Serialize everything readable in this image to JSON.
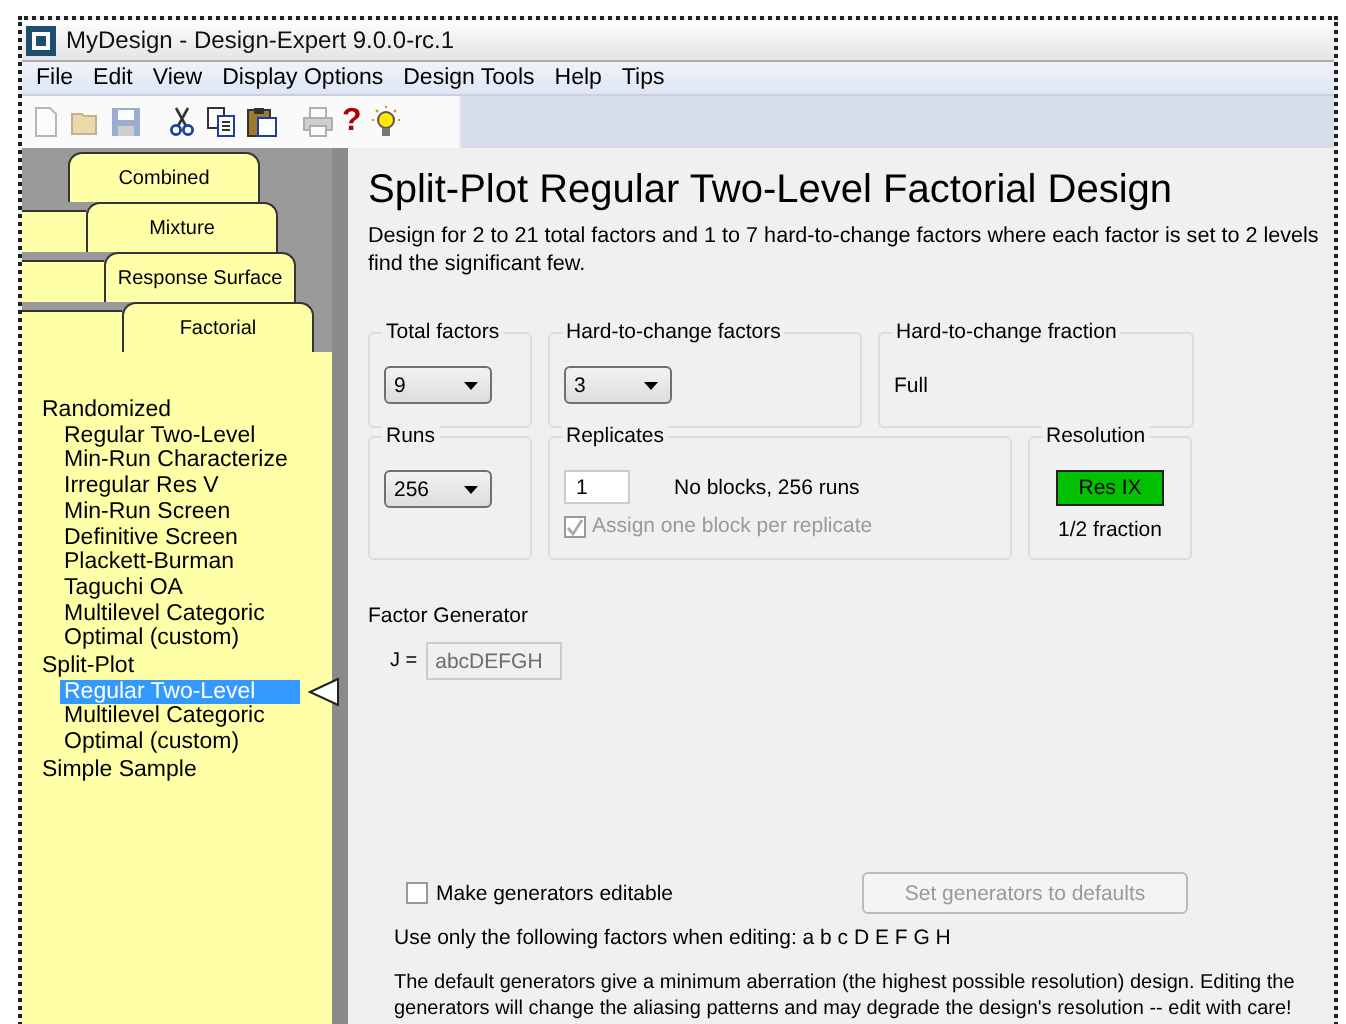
{
  "window": {
    "title": "MyDesign - Design-Expert 9.0.0-rc.1"
  },
  "menu": [
    {
      "label": "File"
    },
    {
      "label": "Edit"
    },
    {
      "label": "View"
    },
    {
      "label": "Display Options"
    },
    {
      "label": "Design Tools"
    },
    {
      "label": "Help"
    },
    {
      "label": "Tips"
    }
  ],
  "toolbar": [
    {
      "kind": "new",
      "disabled": true
    },
    {
      "kind": "open",
      "disabled": true
    },
    {
      "kind": "save",
      "disabled": true
    },
    {
      "kind": "cut",
      "disabled": false,
      "separator_before": true
    },
    {
      "kind": "copy",
      "disabled": false
    },
    {
      "kind": "paste",
      "disabled": false
    },
    {
      "kind": "print",
      "disabled": true,
      "separator_before": true
    },
    {
      "kind": "help",
      "text": "?",
      "disabled": false
    },
    {
      "kind": "tip",
      "disabled": false
    }
  ],
  "tabs": [
    {
      "label": "Combined",
      "selected": false
    },
    {
      "label": "Mixture",
      "selected": false
    },
    {
      "label": "Response Surface",
      "selected": false
    },
    {
      "label": "Factorial",
      "selected": true
    }
  ],
  "tree": [
    {
      "label": "Randomized",
      "selected": false,
      "children": [
        {
          "label": "Regular Two-Level",
          "selected": false
        },
        {
          "label": "Min-Run Characterize",
          "selected": false
        },
        {
          "label": "Irregular Res V",
          "selected": false
        },
        {
          "label": "Min-Run Screen",
          "selected": false
        },
        {
          "label": "Definitive Screen",
          "selected": false
        },
        {
          "label": "Plackett-Burman",
          "selected": false
        },
        {
          "label": "Taguchi OA",
          "selected": false
        },
        {
          "label": "Multilevel Categoric",
          "selected": false
        },
        {
          "label": "Optimal (custom)",
          "selected": false
        }
      ]
    },
    {
      "label": "Split-Plot",
      "selected": false,
      "children": [
        {
          "label": "Regular Two-Level",
          "selected": true
        },
        {
          "label": "Multilevel Categoric",
          "selected": false
        },
        {
          "label": "Optimal (custom)",
          "selected": false
        }
      ]
    },
    {
      "label": "Simple Sample",
      "selected": false
    }
  ],
  "page": {
    "title": "Split-Plot Regular Two-Level Factorial Design",
    "description_lines": [
      "Design for 2 to 21 total factors and 1 to 7 hard-to-change factors where each factor is set to 2 levels",
      "find the significant few."
    ]
  },
  "groups": [
    [
      {
        "title": "Total factors",
        "kind": "dropdown",
        "value": "9"
      },
      {
        "title": "Hard-to-change factors",
        "kind": "dropdown",
        "value": "3"
      },
      {
        "title": "Hard-to-change fraction",
        "kind": "text",
        "value": "Full"
      }
    ],
    [
      {
        "title": "Runs",
        "kind": "dropdown",
        "value": "256"
      },
      {
        "title": "Replicates",
        "kind": "replicates",
        "value": "1",
        "summary": "No blocks, 256 runs",
        "checkbox": {
          "label": "Assign one block per replicate",
          "checked": true,
          "disabled": true
        }
      },
      {
        "title": "Resolution",
        "kind": "resolution",
        "badge": "Res IX",
        "fraction": "1/2 fraction"
      }
    ]
  ],
  "generator": {
    "title": "Factor Generator",
    "rows": [
      {
        "label": "J =",
        "value": "abcDEFGH",
        "disabled": true
      }
    ]
  },
  "editable": {
    "label": "Make generators editable",
    "checked": false
  },
  "defaults_button": {
    "label": "Set generators to defaults",
    "disabled": true
  },
  "factors_note": "Use only the following factors when editing: a b c D E F G H",
  "warning": "The default generators give a minimum aberration (the highest possible resolution) design. Editing the generators will change the aliasing patterns and may degrade the design's resolution -- edit with care!"
}
